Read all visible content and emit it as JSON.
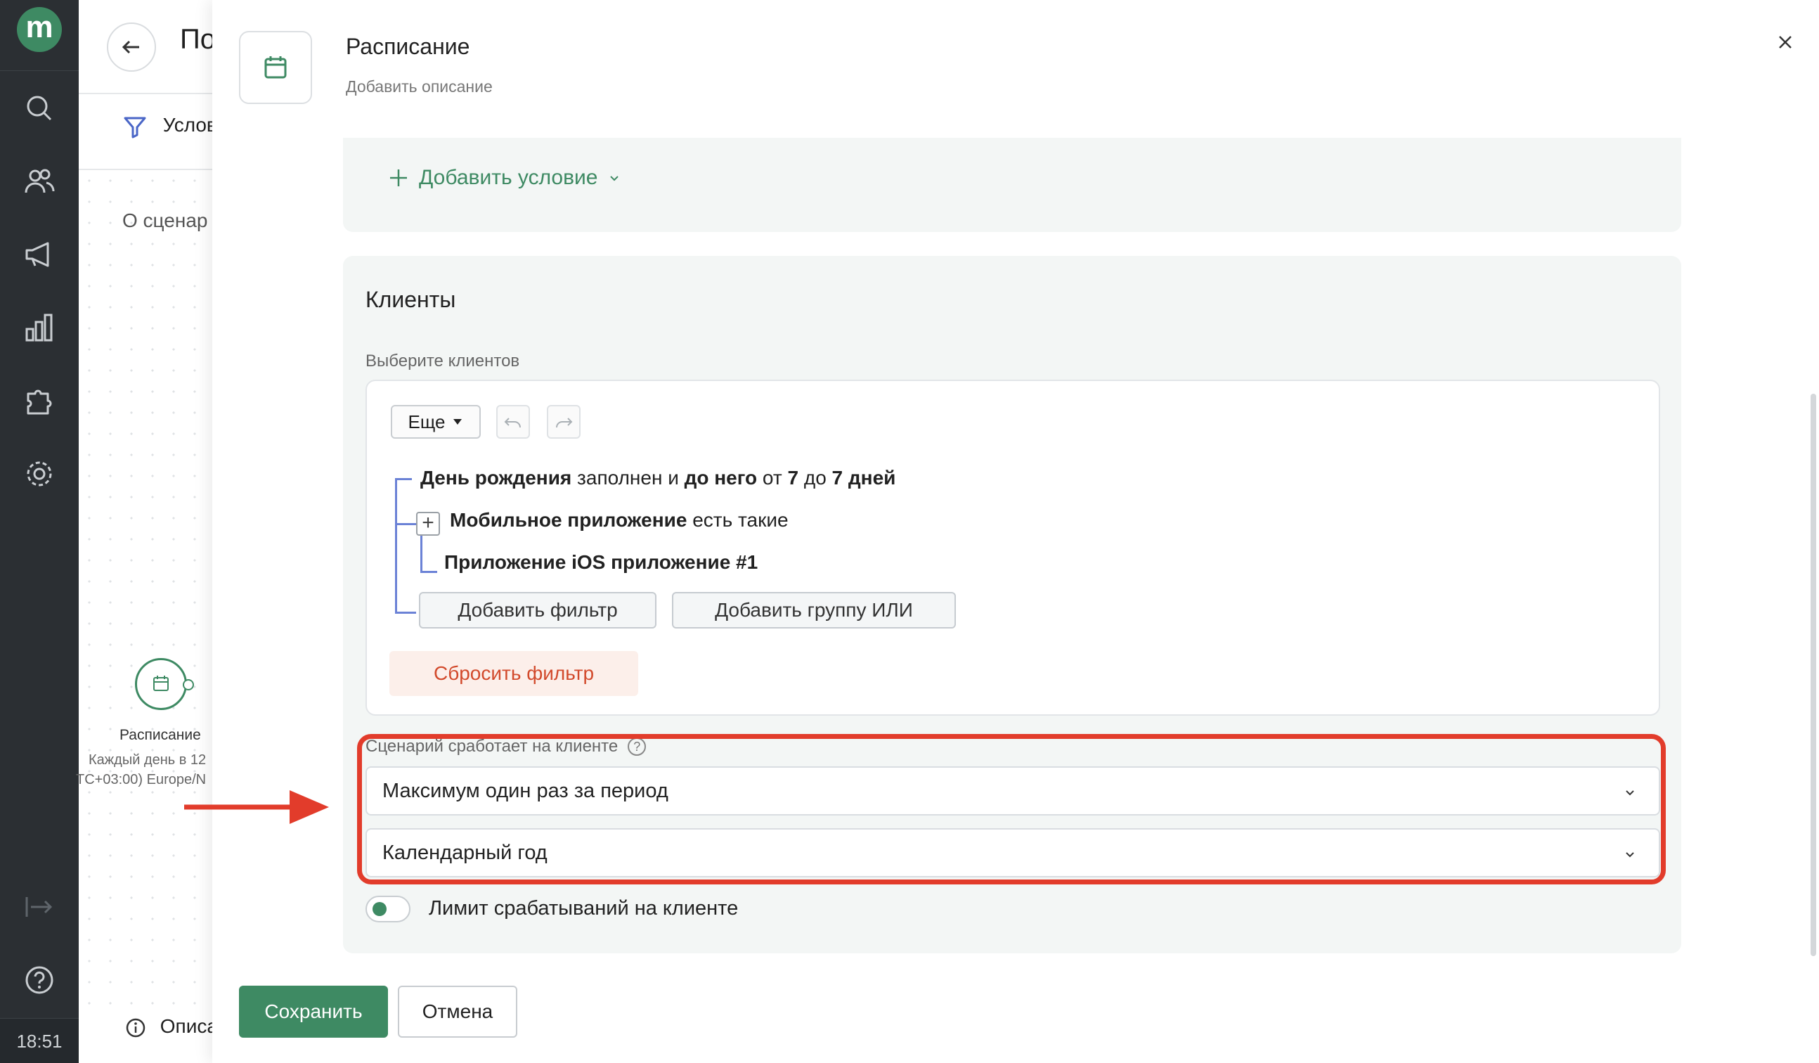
{
  "nav": {
    "logo": "m",
    "time": "18:51"
  },
  "background_page": {
    "title": "По",
    "tab_label": "Услов",
    "about": "О сценар",
    "node_label": "Расписание",
    "node_sub1": "Каждый день в 12",
    "node_sub2": "TC+03:00) Europe/N",
    "description": "Описа"
  },
  "modal": {
    "title": "Расписание",
    "description": "Добавить описание",
    "add_condition": "Добавить условие",
    "clients_title": "Клиенты",
    "clients_label": "Выберите клиентов",
    "more_button": "Еще",
    "filter": {
      "row1": {
        "bold1": "День рождения",
        "t1": " заполнен и ",
        "bold2": "до него",
        "t2": " от ",
        "bold3": "7",
        "t3": " до ",
        "bold4": "7 дней"
      },
      "row2": {
        "bold": "Мобильное приложение",
        "text": " есть такие"
      },
      "row3": {
        "bold": "Приложение iOS приложение #1"
      },
      "add_filter": "Добавить фильтр",
      "add_or_group": "Добавить группу ИЛИ",
      "reset": "Сбросить фильтр"
    },
    "frequency_label": "Сценарий сработает на клиенте",
    "frequency_value": "Максимум один раз за период",
    "period_value": "Календарный год",
    "limit_toggle_label": "Лимит срабатываний на клиенте",
    "save": "Сохранить",
    "cancel": "Отмена"
  },
  "colors": {
    "accent": "#3e8a63",
    "highlight": "#e23c2b",
    "tree_line": "#6b82d6"
  }
}
